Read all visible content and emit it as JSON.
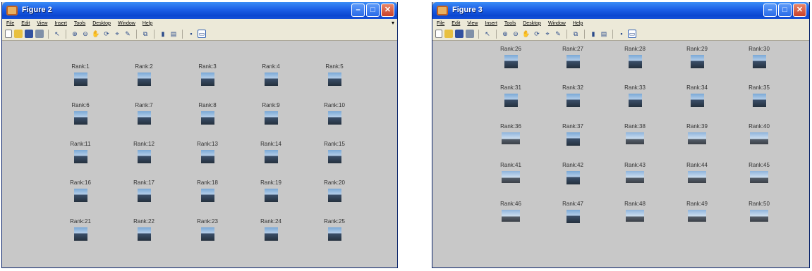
{
  "windows": [
    {
      "title": "Figure 2",
      "menu": [
        "File",
        "Edit",
        "View",
        "Insert",
        "Tools",
        "Desktop",
        "Window",
        "Help"
      ],
      "controls": {
        "minimize": "–",
        "maximize": "□",
        "close": "✕"
      },
      "ranks": [
        "Rank:1",
        "Rank:2",
        "Rank:3",
        "Rank:4",
        "Rank:5",
        "Rank:6",
        "Rank:7",
        "Rank:8",
        "Rank:9",
        "Rank:10",
        "Rank:11",
        "Rank:12",
        "Rank:13",
        "Rank:14",
        "Rank:15",
        "Rank:16",
        "Rank:17",
        "Rank:18",
        "Rank:19",
        "Rank:20",
        "Rank:21",
        "Rank:22",
        "Rank:23",
        "Rank:24",
        "Rank:25"
      ]
    },
    {
      "title": "Figure 3",
      "menu": [
        "File",
        "Edit",
        "View",
        "Insert",
        "Tools",
        "Desktop",
        "Window",
        "Help"
      ],
      "controls": {
        "minimize": "–",
        "maximize": "□",
        "close": "✕"
      },
      "ranks": [
        "Rank:26",
        "Rank:27",
        "Rank:28",
        "Rank:29",
        "Rank:30",
        "Rank:31",
        "Rank:32",
        "Rank:33",
        "Rank:34",
        "Rank:35",
        "Rank:36",
        "Rank:37",
        "Rank:38",
        "Rank:39",
        "Rank:40",
        "Rank:41",
        "Rank:42",
        "Rank:43",
        "Rank:44",
        "Rank:45",
        "Rank:46",
        "Rank:47",
        "Rank:48",
        "Rank:49",
        "Rank:50"
      ]
    }
  ],
  "toolbar_icons": [
    "new-file-icon",
    "open-folder-icon",
    "save-icon",
    "print-icon",
    "separator",
    "pointer-icon",
    "separator",
    "zoom-in-icon",
    "zoom-out-icon",
    "pan-icon",
    "rotate-3d-icon",
    "data-cursor-icon",
    "brush-icon",
    "separator",
    "link-icon",
    "separator",
    "colorbar-icon",
    "legend-icon",
    "separator",
    "hide-plot-tools-icon",
    "show-plot-tools-icon"
  ],
  "colors": {
    "titlebar": "#0a46d0",
    "figure_bg": "#c8c8c8",
    "menubar_bg": "#ece9d8"
  }
}
